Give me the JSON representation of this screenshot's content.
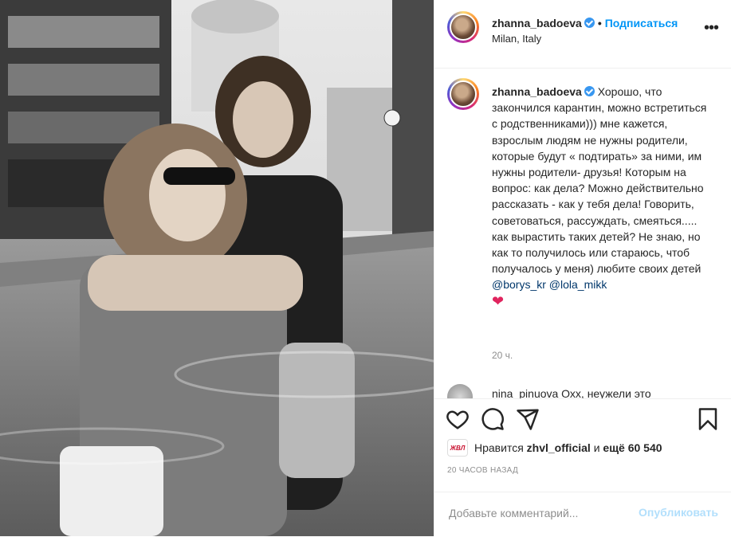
{
  "post": {
    "username": "zhanna_badoeva",
    "separator": "•",
    "follow_label": "Подписаться",
    "location": "Milan, Italy",
    "more_label": "•••"
  },
  "caption": {
    "username": "zhanna_badoeva",
    "text": "Хорошо, что закончился карантин, можно встретиться с родственниками))) мне кажется, взрослым людям не нужны родители, которые будут « подтирать» за ними, им нужны родители- друзья! Которым на вопрос: как дела? Можно действительно рассказать - как у тебя дела! Говорить, советоваться, рассуждать, смеяться..... как вырастить таких детей? Не знаю, но как то получилось или стараюсь, чтоб получалось у меня) любите своих детей",
    "mention1": "@borys_kr",
    "mention2": "@lola_mikk",
    "emoji": "❤",
    "time": "20 ч."
  },
  "next_comment": {
    "text": "nina_pinuova Охх, неужели это"
  },
  "likes": {
    "avatar_text": "ЖВЛ",
    "prefix": "Нравится",
    "user": "zhvl_official",
    "middle": "и",
    "count": "ещё 60 540"
  },
  "timestamp": "20 ЧАСОВ НАЗАД",
  "add_comment": {
    "placeholder": "Добавьте комментарий...",
    "post_label": "Опубликовать"
  },
  "icons": {
    "like": "heart-icon",
    "comment": "comment-icon",
    "share": "share-icon",
    "save": "bookmark-icon"
  },
  "colors": {
    "link": "#0095f6",
    "mention": "#00376b",
    "verified": "#3897f0",
    "muted": "#8e8e8e"
  }
}
